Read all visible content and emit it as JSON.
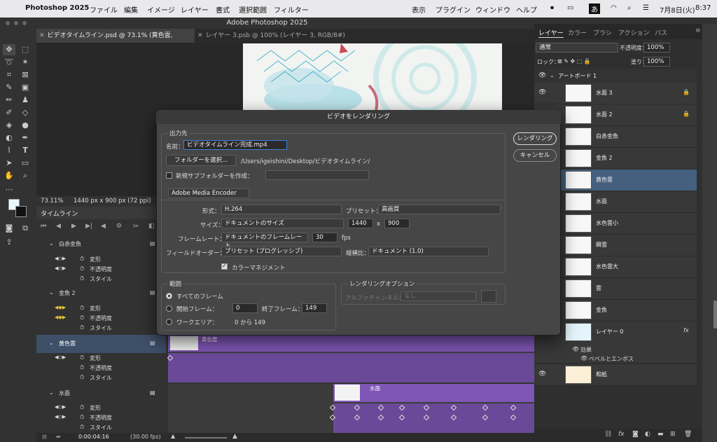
{
  "menubar": {
    "app": "Photoshop 2025",
    "items": [
      "ファイル",
      "編集",
      "イメージ",
      "レイヤー",
      "書式",
      "選択範囲",
      "フィルター",
      "表示",
      "プラグイン",
      "ウィンドウ",
      "ヘルプ"
    ],
    "ime": "あ",
    "date": "7月8日(火)",
    "time": "8:37"
  },
  "window": {
    "title": "Adobe Photoshop 2025"
  },
  "tabs": [
    "ビデオタイムライン.psd @ 73.1% (黄色雲, RGB/8#)",
    "レイヤー 3.psb @ 100% (レイヤー 3, RGB/8#)"
  ],
  "status": {
    "zoom": "73.11%",
    "size": "1440 px x 900 px (72 ppi)"
  },
  "timeline": {
    "tab": "タイムライン",
    "time": "0:00:04:16",
    "fps": "(30.00 fps)",
    "layers": [
      {
        "name": "白赤金魚",
        "props": [
          "変形",
          "不透明度",
          "スタイル"
        ]
      },
      {
        "name": "金魚 2",
        "props": [
          "変形",
          "不透明度",
          "スタイル"
        ]
      },
      {
        "name": "黄色雲",
        "props": [
          "変形",
          "不透明度",
          "スタイル"
        ],
        "clip": "黄色雲"
      },
      {
        "name": "水面",
        "props": [
          "変形",
          "不透明度",
          "スタイル"
        ],
        "clip": "水面"
      }
    ]
  },
  "layers_panel": {
    "tabs": [
      "レイヤー",
      "カラー",
      "ブラシ",
      "アクション",
      "パス"
    ],
    "blend": "通常",
    "opacity_label": "不透明度：",
    "opacity": "100%",
    "lock_label": "ロック：",
    "fill_label": "塗り：",
    "fill": "100%",
    "artboard": "アートボード 1",
    "layers": [
      "水面 3",
      "水面 2",
      "白赤金魚",
      "金魚 2",
      "黄色雲",
      "水面",
      "水色雲小",
      "瞬雲",
      "水色雲大",
      "雲",
      "金魚",
      "レイヤー 0",
      "和紙"
    ],
    "effects": "効果",
    "bevel": "ベベルとエンボス"
  },
  "dialog": {
    "title": "ビデオをレンダリング",
    "output_group": "出力先",
    "name_label": "名前：",
    "name_value": "ビデオタイムライン完成.mp4",
    "folder_button": "フォルダーを選択...",
    "path": "/Users/igeishini/Desktop/ビデオタイムライン/",
    "subfolder_label": "新規サブフォルダーを作成：",
    "encoder": "Adobe Media Encoder",
    "format_label": "形式：",
    "format": "H.264",
    "preset_label": "プリセット：",
    "preset": "高画質",
    "size_label": "サイズ：",
    "size": "ドキュメントのサイズ",
    "width": "1440",
    "x": "x",
    "height": "900",
    "framerate_label": "フレームレート：",
    "framerate": "ドキュメントのフレームレート",
    "fps_value": "30",
    "fps_unit": "fps",
    "field_label": "フィールドオーダー：",
    "field": "プリセット (プログレッシブ)",
    "aspect_label": "縦横比：",
    "aspect": "ドキュメント (1.0)",
    "color_mgmt": "カラーマネジメント",
    "range_group": "範囲",
    "all_frames": "すべてのフレーム",
    "start_label": "開始フレーム：",
    "start": "0",
    "end_label": "終了フレーム：",
    "end": "149",
    "workarea_label": "ワークエリア：",
    "workarea": "0 から 149",
    "render_options": "レンダリングオプション",
    "alpha_label": "アルファチャンネル：",
    "alpha": "なし",
    "render_button": "レンダリング",
    "cancel_button": "キャンセル"
  }
}
